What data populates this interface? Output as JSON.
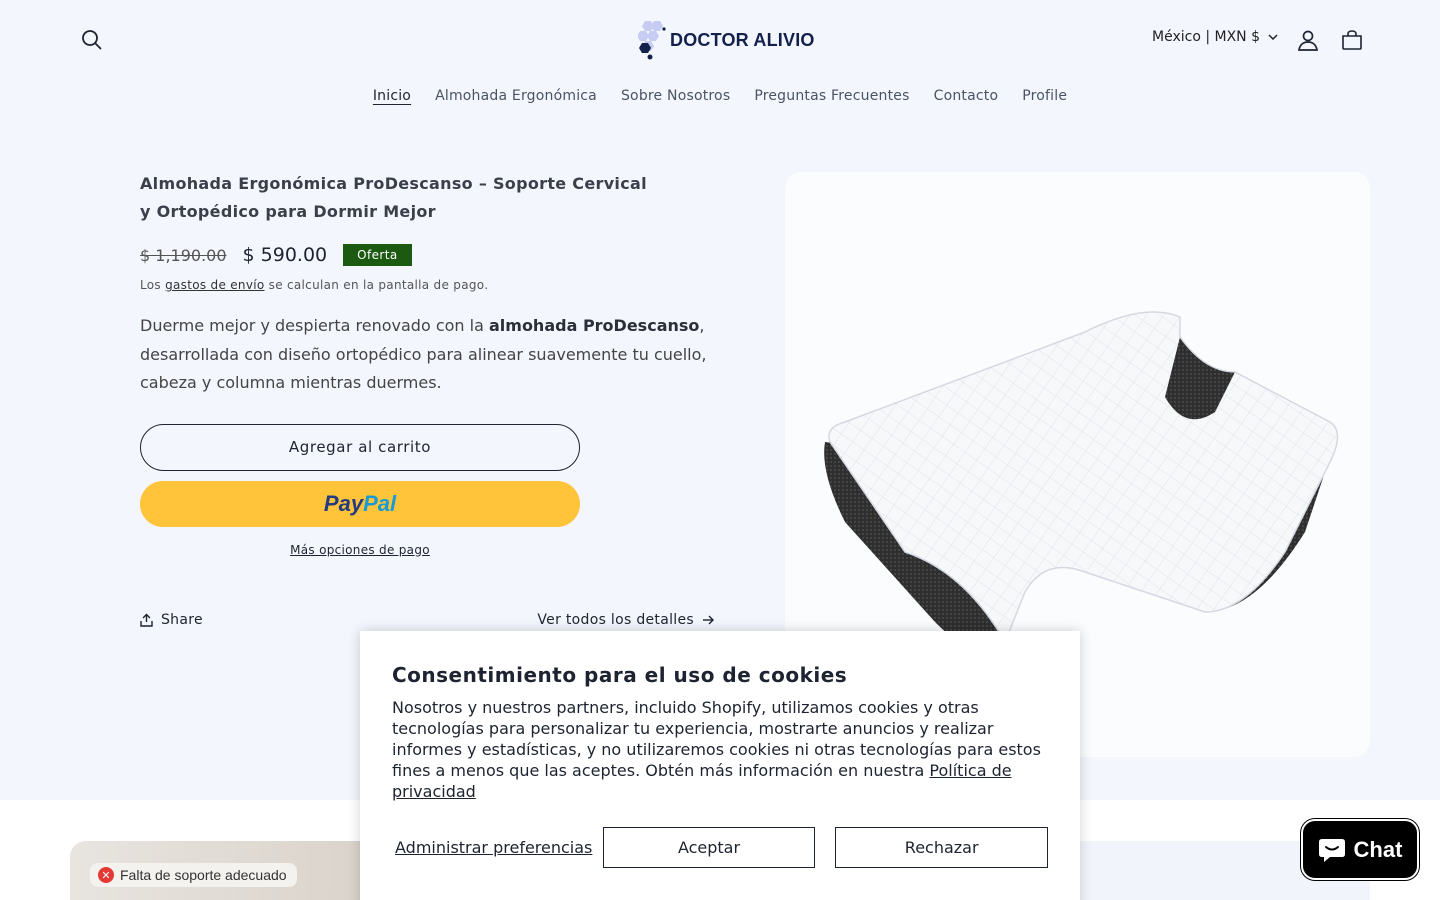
{
  "header": {
    "logo_text": "DOCTOR ALIVIO",
    "locale": "México | MXN $",
    "nav": [
      {
        "label": "Inicio"
      },
      {
        "label": "Almohada Ergonómica"
      },
      {
        "label": "Sobre Nosotros"
      },
      {
        "label": "Preguntas Frecuentes"
      },
      {
        "label": "Contacto"
      },
      {
        "label": "Profile"
      }
    ]
  },
  "product": {
    "title": "Almohada Ergonómica ProDescanso – Soporte Cervical y Ortopédico para Dormir Mejor",
    "price_old": "$ 1,190.00",
    "price_new": "$ 590.00",
    "badge": "Oferta",
    "shipping_pre": "Los",
    "shipping_link": "gastos de envío",
    "shipping_post": "se calculan en la pantalla de pago.",
    "desc_pre": "Duerme mejor y despierta renovado con la",
    "desc_bold": "almohada ProDescanso",
    "desc_post": ", desarrollada con diseño ortopédico para alinear suavemente tu cuello, cabeza y columna mientras duermes.",
    "add_to_cart": "Agregar al carrito",
    "paypal_p1": "Pay",
    "paypal_p2": "Pal",
    "more_options": "Más opciones de pago",
    "share": "Share",
    "view_details": "Ver todos los detalles"
  },
  "lower": {
    "tag_label": "Falta de soporte adecuado"
  },
  "cookie": {
    "title": "Consentimiento para el uso de cookies",
    "body": "Nosotros y nuestros partners, incluido Shopify, utilizamos cookies y otras tecnologías para personalizar tu experiencia, mostrarte anuncios y realizar informes y estadísticas, y no utilizaremos cookies ni otras tecnologías para estos fines a menos que las aceptes. Obtén más información en nuestra",
    "policy_link": "Política de privacidad",
    "manage": "Administrar preferencias",
    "accept": "Aceptar",
    "reject": "Rechazar"
  },
  "chat": {
    "label": "Chat"
  },
  "colors": {
    "background": "#f3f6fd",
    "badge": "#1c5a12",
    "paypal": "#ffc439",
    "chat": "#000000"
  }
}
